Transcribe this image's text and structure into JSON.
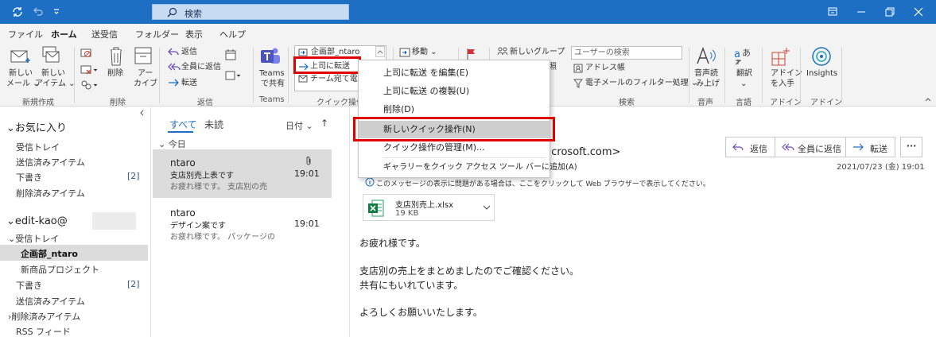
{
  "titlebar": {
    "search_text": "検索"
  },
  "menu": {
    "tabs": [
      "ファイル",
      "ホーム",
      "送受信",
      "フォルダー",
      "表示",
      "ヘルプ"
    ]
  },
  "ribbon": {
    "new_mail": [
      "新しい",
      "メール ⌄"
    ],
    "new_items": [
      "新しい",
      "アイテム ⌄"
    ],
    "delete": "削除",
    "archive": [
      "アー",
      "カイブ"
    ],
    "reply": "返信",
    "reply_all": "全員に返信",
    "forward": "転送",
    "teams": [
      "Teams",
      "で共有"
    ],
    "quick_combo": "企画部_ntaro",
    "quick_item1": "上司に転送",
    "quick_item2": "チーム宛て電子",
    "move": "移動 ⌄",
    "new_group": "新しいグループ",
    "partial_text": "照",
    "user_search_placeholder": "ユーザーの検索",
    "address_book": "アドレス帳",
    "filter_email": "電子メールのフィルター処理 ⌄",
    "read_aloud": [
      "音声読",
      "み上げ"
    ],
    "translate": [
      "翻訳",
      "⌄"
    ],
    "get_addins": [
      "アドイン",
      "を入手"
    ],
    "insights": "Insights",
    "groups": [
      "新規作成",
      "削除",
      "返信",
      "Teams",
      "クイック操作",
      "検索",
      "音声",
      "言語",
      "アドイン",
      "アドイン"
    ]
  },
  "folders": {
    "favorites_header": "⌄お気に入り",
    "fav": [
      "受信トレイ",
      "送信済みアイテム",
      "下書き",
      "削除済みアイテム"
    ],
    "fav_drafts_count": "[2]",
    "account_header": "⌄edit-kao@",
    "inbox": "⌄受信トレイ",
    "sub1": "企画部_ntaro",
    "sub2": "新商品プロジェクト",
    "drafts": "下書き",
    "drafts_count": "[2]",
    "sent": "送信済みアイテム",
    "deleted": "›削除済みアイテム",
    "rss": "RSS フィード"
  },
  "list": {
    "tab_all": "すべて",
    "tab_unread": "未読",
    "sort": "日付 ⌄",
    "sort_arrow": "↑",
    "group_today": "⌄ 今日",
    "messages": [
      {
        "sender": "ntaro",
        "subject": "支店別売上表です",
        "preview": "お疲れ様です。 支店別の売",
        "time": "19:01"
      },
      {
        "sender": "ntaro",
        "subject": "デザイン案です",
        "preview": "お疲れ様です。 パッケージの",
        "time": "19:01"
      }
    ]
  },
  "reading": {
    "from_partial": "microsoft.com>",
    "btn_reply": "返信",
    "btn_reply_all": "全員に返信",
    "btn_forward": "転送",
    "btn_more": "···",
    "date": "2021/07/23 (金) 19:01",
    "info": "このメッセージの表示に問題がある場合は、ここをクリックして Web ブラウザーで表示してください。",
    "attachment_name": "支店別売上.xlsx",
    "attachment_size": "19 KB",
    "body": [
      "お疲れ様です。",
      "支店別の売上をまとめましたのでご確認ください。",
      "共有にもいれています。",
      "よろしくお願いいたします。"
    ]
  },
  "dropdown": {
    "items": [
      "上司に転送 を編集(E)",
      "上司に転送 の複製(U)",
      "削除(D)",
      "新しいクイック操作(N)",
      "クイック操作の管理(M)...",
      "ギャラリーをクイック アクセス ツール バーに追加(A)"
    ]
  },
  "colors": {
    "accent": "#1d6fc4",
    "highlight": "#e00000"
  }
}
